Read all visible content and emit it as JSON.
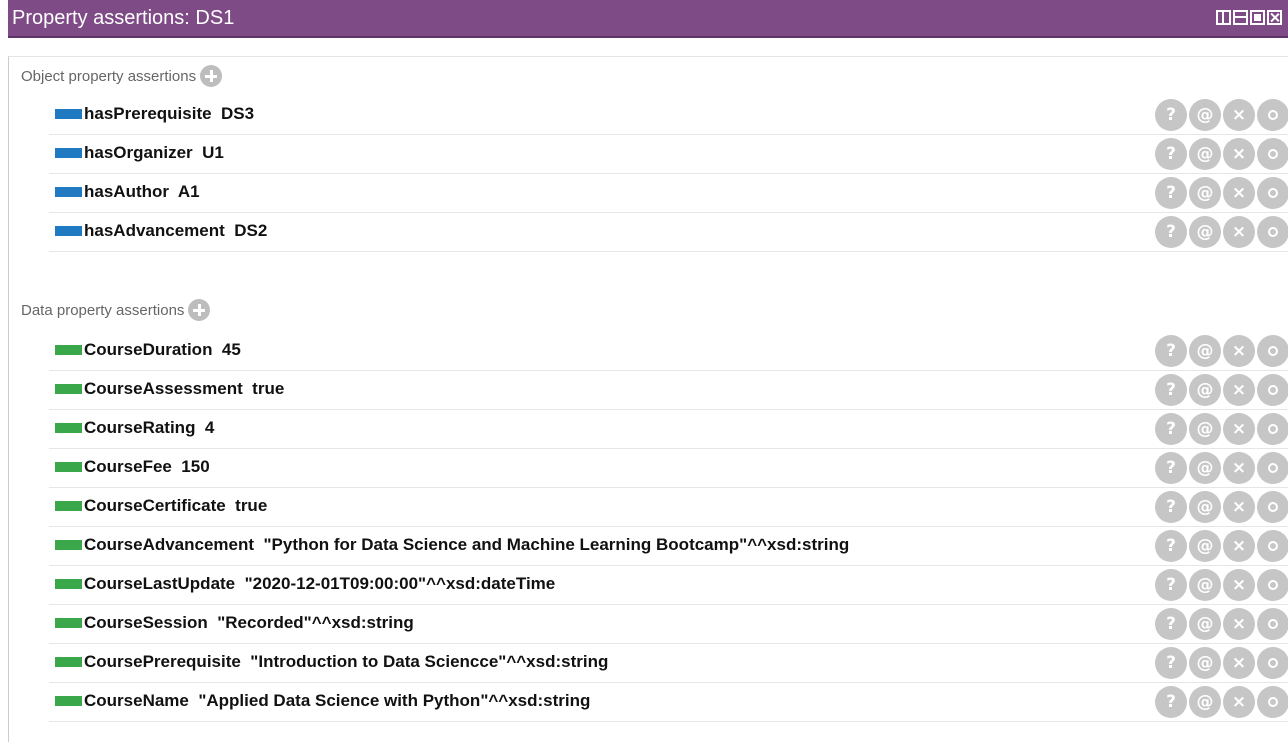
{
  "panel": {
    "title": "Property assertions: DS1"
  },
  "object_section": {
    "label": "Object property assertions",
    "items": [
      {
        "text": "hasPrerequisite  DS3"
      },
      {
        "text": "hasOrganizer  U1"
      },
      {
        "text": "hasAuthor  A1"
      },
      {
        "text": "hasAdvancement  DS2"
      }
    ]
  },
  "data_section": {
    "label": "Data property assertions",
    "items": [
      {
        "text": "CourseDuration  45"
      },
      {
        "text": "CourseAssessment  true"
      },
      {
        "text": "CourseRating  4"
      },
      {
        "text": "CourseFee  150"
      },
      {
        "text": "CourseCertificate  true"
      },
      {
        "text": "CourseAdvancement  \"Python for Data Science and Machine Learning Bootcamp\"^^xsd:string"
      },
      {
        "text": "CourseLastUpdate  \"2020-12-01T09:00:00\"^^xsd:dateTime"
      },
      {
        "text": "CourseSession  \"Recorded\"^^xsd:string"
      },
      {
        "text": "CoursePrerequisite  \"Introduction to Data Sciencce\"^^xsd:string"
      },
      {
        "text": "CourseName  \"Applied Data Science with Python\"^^xsd:string"
      }
    ]
  },
  "action_labels": {
    "help": "?",
    "annotate": "@",
    "delete": "×"
  },
  "icons": {
    "window_buttons": [
      "vertical-split-icon",
      "horizontal-split-icon",
      "maximize-icon",
      "close-icon"
    ],
    "add": "add-circle-icon",
    "row_actions": [
      "help-icon",
      "annotate-icon",
      "delete-icon",
      "edit-icon"
    ]
  },
  "colors": {
    "titlebar": "#7e4b86",
    "object_property": "#1f7ac2",
    "data_property": "#3aa84a",
    "action_button": "#c6c6c6"
  }
}
